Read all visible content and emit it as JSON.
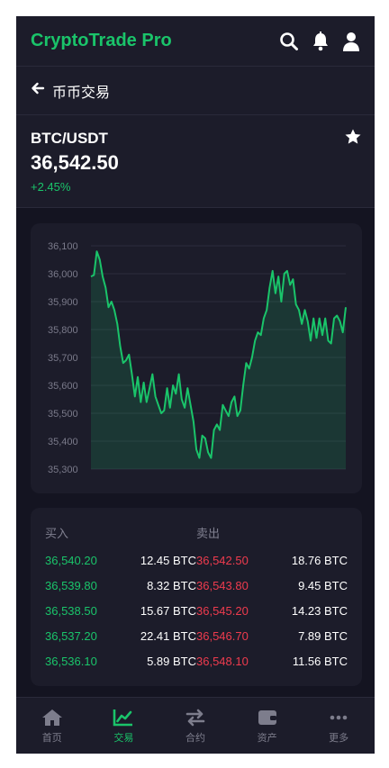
{
  "app": {
    "brand": "CryptoTrade Pro"
  },
  "header": {
    "back_label": "币币交易"
  },
  "pair": {
    "name": "BTC/USDT",
    "price": "36,542.50",
    "change": "+2.45%"
  },
  "colors": {
    "accent": "#1ac46a",
    "sell": "#ef3b4e",
    "background": "#141421",
    "card": "#1c1c2a"
  },
  "icons": {
    "search": "search-icon",
    "bell": "bell-icon",
    "user": "user-icon",
    "back": "arrow-left-icon",
    "favorite": "star-icon"
  },
  "chart_data": {
    "type": "area",
    "title": "",
    "xlabel": "",
    "ylabel": "",
    "ylim": [
      35300,
      36100
    ],
    "yticks": [
      "36,100",
      "36,000",
      "35,900",
      "35,800",
      "35,700",
      "35,600",
      "35,500",
      "35,400",
      "35,300"
    ],
    "grid": true,
    "series": [
      {
        "color": "#1ac46a",
        "values": [
          35990,
          35995,
          36080,
          36050,
          35990,
          35950,
          35880,
          35900,
          35870,
          35820,
          35740,
          35680,
          35690,
          35710,
          35640,
          35560,
          35630,
          35540,
          35610,
          35540,
          35590,
          35640,
          35560,
          35530,
          35500,
          35510,
          35590,
          35520,
          35600,
          35570,
          35640,
          35550,
          35520,
          35590,
          35530,
          35470,
          35370,
          35340,
          35420,
          35410,
          35360,
          35340,
          35440,
          35460,
          35440,
          35530,
          35510,
          35490,
          35540,
          35560,
          35490,
          35510,
          35600,
          35680,
          35660,
          35700,
          35760,
          35790,
          35780,
          35840,
          35870,
          35950,
          36010,
          35930,
          35990,
          35900,
          36000,
          36010,
          35960,
          35980,
          35890,
          35870,
          35820,
          35870,
          35830,
          35760,
          35840,
          35770,
          35840,
          35780,
          35840,
          35760,
          35750,
          35840,
          35850,
          35830,
          35790,
          35880
        ]
      }
    ]
  },
  "orderbook": {
    "buy_header": "买入",
    "sell_header": "卖出",
    "rows": [
      {
        "bid_price": "36,540.20",
        "bid_amount": "12.45 BTC",
        "ask_price": "36,542.50",
        "ask_amount": "18.76 BTC"
      },
      {
        "bid_price": "36,539.80",
        "bid_amount": "8.32 BTC",
        "ask_price": "36,543.80",
        "ask_amount": "9.45 BTC"
      },
      {
        "bid_price": "36,538.50",
        "bid_amount": "15.67 BTC",
        "ask_price": "36,545.20",
        "ask_amount": "14.23 BTC"
      },
      {
        "bid_price": "36,537.20",
        "bid_amount": "22.41 BTC",
        "ask_price": "36,546.70",
        "ask_amount": "7.89 BTC"
      },
      {
        "bid_price": "36,536.10",
        "bid_amount": "5.89 BTC",
        "ask_price": "36,548.10",
        "ask_amount": "11.56 BTC"
      }
    ]
  },
  "nav": {
    "items": [
      {
        "label": "首页",
        "icon": "home-icon"
      },
      {
        "label": "交易",
        "icon": "chart-line-icon",
        "active": true
      },
      {
        "label": "合约",
        "icon": "exchange-icon"
      },
      {
        "label": "资产",
        "icon": "wallet-icon"
      },
      {
        "label": "更多",
        "icon": "more-icon"
      }
    ]
  }
}
